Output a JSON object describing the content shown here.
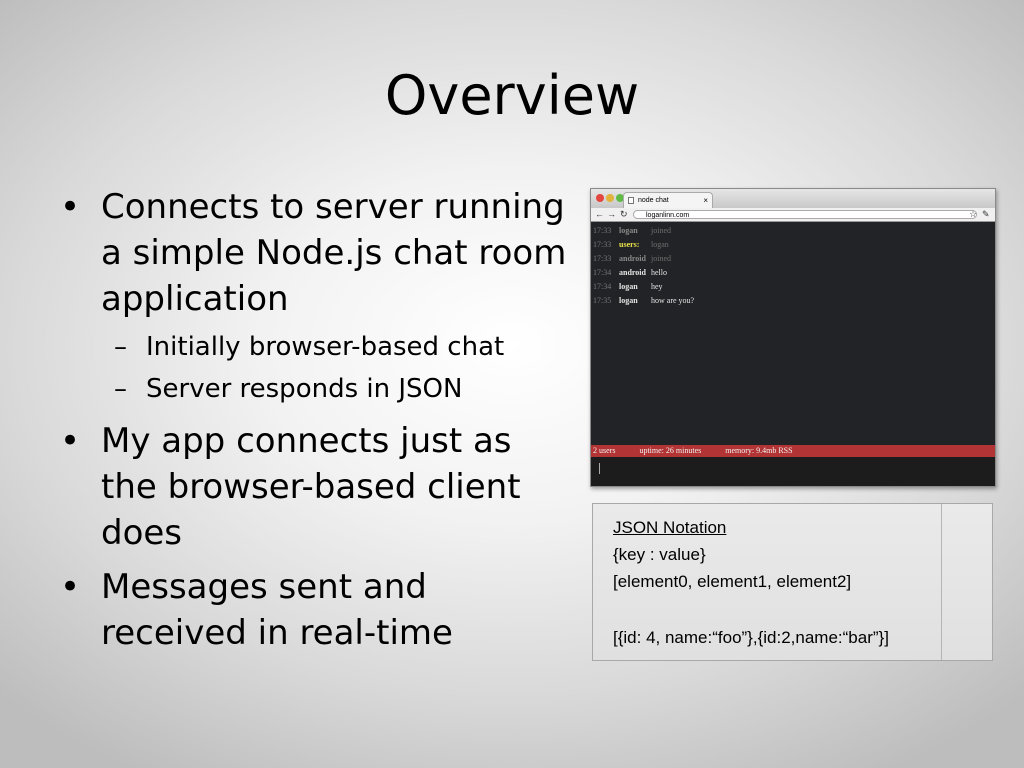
{
  "slide": {
    "title": "Overview",
    "bullets": [
      {
        "text": "Connects to server running a simple Node.js chat room application",
        "sub": [
          "Initially browser-based chat",
          "Server responds in JSON"
        ]
      },
      {
        "text": "My app connects just as the browser-based client does"
      },
      {
        "text": "Messages sent and received in real-time"
      }
    ]
  },
  "browser": {
    "tab_title": "node chat",
    "url": "loganlinn.com",
    "messages": [
      {
        "time": "17:33",
        "user": "logan",
        "text": "joined",
        "dim": true
      },
      {
        "time": "17:33",
        "user": "users:",
        "text": "logan",
        "dim": true,
        "user_color": "#e8e34a"
      },
      {
        "time": "17:33",
        "user": "android",
        "text": "joined",
        "dim": true
      },
      {
        "time": "17:34",
        "user": "android",
        "text": "hello"
      },
      {
        "time": "17:34",
        "user": "logan",
        "text": "hey"
      },
      {
        "time": "17:35",
        "user": "logan",
        "text": "how are you?"
      }
    ],
    "status": {
      "users": "2 users",
      "uptime": "uptime: 26 minutes",
      "memory": "memory: 9.4mb RSS"
    },
    "colors": {
      "status_bar": "#b33434",
      "chat_bg": "#222326"
    }
  },
  "json_box": {
    "heading": "JSON Notation",
    "line1": "{key : value}",
    "line2": "[element0, element1, element2]",
    "line3": "[{id: 4, name:“foo”},{id:2,name:“bar”}]"
  }
}
